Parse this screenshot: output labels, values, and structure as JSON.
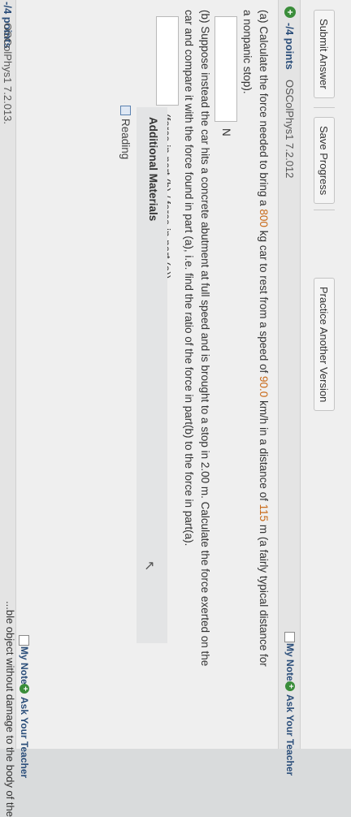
{
  "toolbar": {
    "submit_label": "Submit Answer",
    "save_label": "Save Progress",
    "practice_label": "Practice Another Version"
  },
  "question": {
    "points": "-/4 points",
    "id": "OSColPhys1 7.2.012",
    "my_notes": "My Notes",
    "ask_teacher": "Ask Your Teacher",
    "part_a_1": "(a) Calculate the force needed to bring a ",
    "part_a_mass": "800",
    "part_a_2": " kg car to rest from a speed of ",
    "part_a_speed": "90.0",
    "part_a_3": " km/h in a distance of ",
    "part_a_distance": "115",
    "part_a_4": " m (a fairly typical distance for",
    "part_a_line2": "a nonpanic stop).",
    "part_a_unit": "N",
    "part_b_line1": "(b) Suppose instead the car hits a concrete abutment at full speed and is brought to a stop in 2.00 m. Calculate the force exerted on the",
    "part_b_line2": "car and compare it with the force found in part (a), i.e. find the ratio of the force in part(b) to the force in part(a).",
    "part_b_unit": "(force in part (b) / force in part (a))",
    "answer_a_value": "",
    "answer_b_value": ""
  },
  "materials": {
    "title": "Additional Materials",
    "reading": "Reading"
  },
  "next_question": {
    "points": "-/4 points",
    "id": "OSColPhys1 7.2.013.",
    "my_notes": "My Notes",
    "ask_teacher": "Ask Your Teacher",
    "visible_text": "...ble object without damage to the body of the"
  },
  "colors": {
    "highlight": "#c96b1a",
    "link": "#2b4e7a",
    "plus_icon": "#3a8d3a"
  }
}
